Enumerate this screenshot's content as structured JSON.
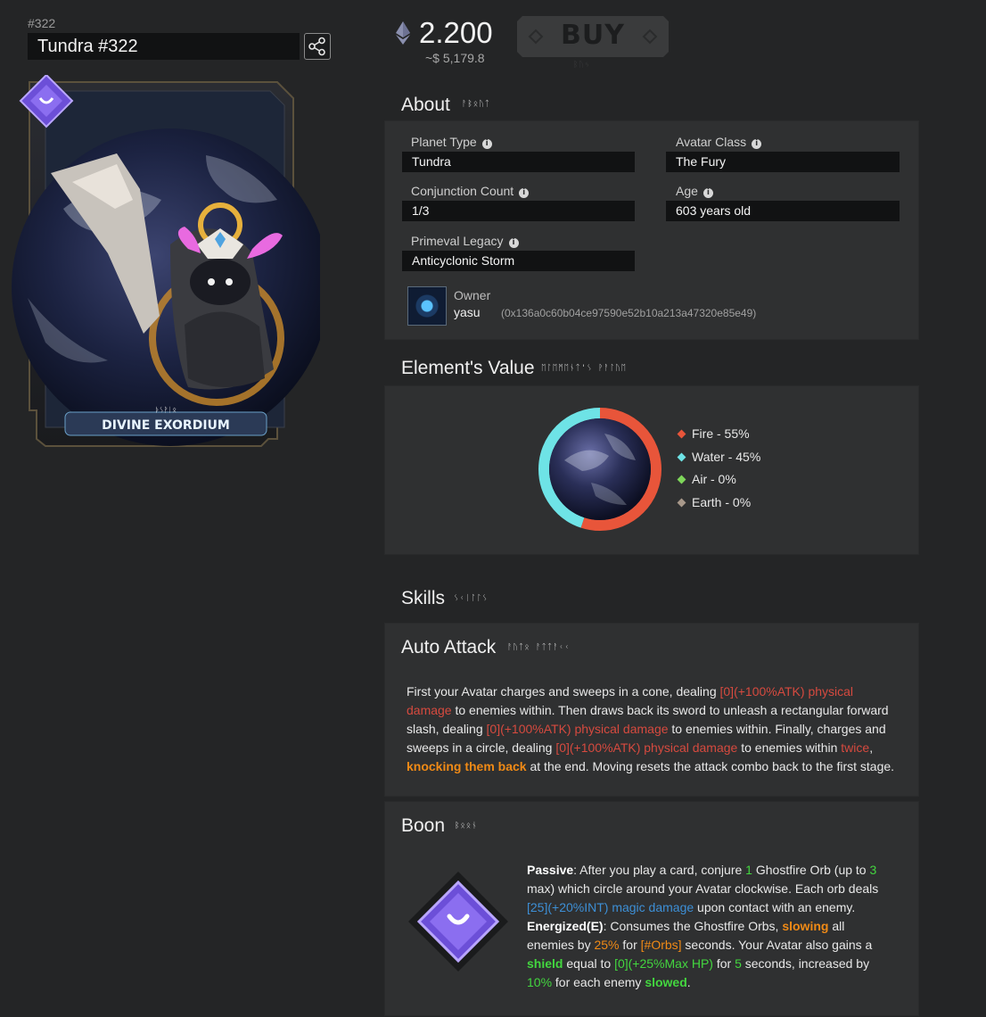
{
  "header": {
    "token_id": "#322",
    "title": "Tundra #322",
    "share_icon": "share-icon"
  },
  "card": {
    "brand_text": "DIVINE EXORDIUM",
    "badge_icon": "emblem-diamond-icon"
  },
  "price": {
    "currency_icon": "ethereum-icon",
    "eth": "2.200",
    "usd": "~$ 5,179.8"
  },
  "buy": {
    "label": "BUY"
  },
  "about": {
    "title": "About",
    "fields": [
      {
        "label": "Planet Type",
        "value": "Tundra"
      },
      {
        "label": "Avatar Class",
        "value": "The Fury"
      },
      {
        "label": "Conjunction Count",
        "value": "1/3"
      },
      {
        "label": "Age",
        "value": "603 years old"
      },
      {
        "label": "Primeval Legacy",
        "value": "Anticyclonic Storm"
      }
    ],
    "owner": {
      "label": "Owner",
      "name": "yasu",
      "address": "(0x136a0c60b04ce97590e52b10a213a47320e85e49)"
    }
  },
  "elements": {
    "title": "Element's Value",
    "items": [
      {
        "label": "Fire - 55%",
        "color": "#e8553a",
        "percent": 55
      },
      {
        "label": "Water - 45%",
        "color": "#6ee3e6",
        "percent": 45
      },
      {
        "label": "Air - 0%",
        "color": "#7ed65a",
        "percent": 0
      },
      {
        "label": "Earth - 0%",
        "color": "#a8988a",
        "percent": 0
      }
    ]
  },
  "skills": {
    "title": "Skills",
    "auto_attack": {
      "title": "Auto Attack",
      "text": [
        {
          "t": "First your Avatar charges and sweeps in a cone, dealing ",
          "c": ""
        },
        {
          "t": "[0](+100%ATK) physical damage",
          "c": "red"
        },
        {
          "t": " to enemies within. Then draws back its sword to unleash a rectangular forward slash, dealing ",
          "c": ""
        },
        {
          "t": "[0](+100%ATK) physical damage",
          "c": "red"
        },
        {
          "t": " to enemies within. Finally, charges and sweeps in a circle, dealing ",
          "c": ""
        },
        {
          "t": "[0](+100%ATK) physical damage",
          "c": "red"
        },
        {
          "t": " to enemies within ",
          "c": ""
        },
        {
          "t": "twice",
          "c": "red"
        },
        {
          "t": ", ",
          "c": ""
        },
        {
          "t": "knocking them back",
          "c": "orange"
        },
        {
          "t": " at the end. Moving resets the attack combo back to the first stage.",
          "c": ""
        }
      ]
    },
    "boon": {
      "title": "Boon",
      "icon": "boon-emblem-icon",
      "text": [
        {
          "t": "Passive",
          "c": "bold"
        },
        {
          "t": ": After you play a card, conjure ",
          "c": ""
        },
        {
          "t": "1",
          "c": "green"
        },
        {
          "t": " Ghostfire Orb (up to ",
          "c": ""
        },
        {
          "t": "3",
          "c": "green"
        },
        {
          "t": " max) which circle around your Avatar clockwise. Each orb deals ",
          "c": ""
        },
        {
          "t": "[25](+20%INT) magic damage",
          "c": "blue"
        },
        {
          "t": " upon contact with an enemy. ",
          "c": ""
        },
        {
          "t": "Energized(E)",
          "c": "bold"
        },
        {
          "t": ": Consumes the Ghostfire Orbs, ",
          "c": ""
        },
        {
          "t": "slowing",
          "c": "orange"
        },
        {
          "t": " all enemies by ",
          "c": ""
        },
        {
          "t": "25%",
          "c": "orange-n"
        },
        {
          "t": " for ",
          "c": ""
        },
        {
          "t": "[#Orbs]",
          "c": "orange-n"
        },
        {
          "t": " seconds. Your Avatar also gains a ",
          "c": ""
        },
        {
          "t": "shield",
          "c": "green-b"
        },
        {
          "t": " equal to ",
          "c": ""
        },
        {
          "t": "[0](+25%Max HP)",
          "c": "green"
        },
        {
          "t": " for ",
          "c": ""
        },
        {
          "t": "5",
          "c": "green"
        },
        {
          "t": " seconds, increased by ",
          "c": ""
        },
        {
          "t": "10%",
          "c": "green"
        },
        {
          "t": " for each enemy ",
          "c": ""
        },
        {
          "t": "slowed",
          "c": "green-b"
        },
        {
          "t": ".",
          "c": ""
        }
      ]
    }
  }
}
